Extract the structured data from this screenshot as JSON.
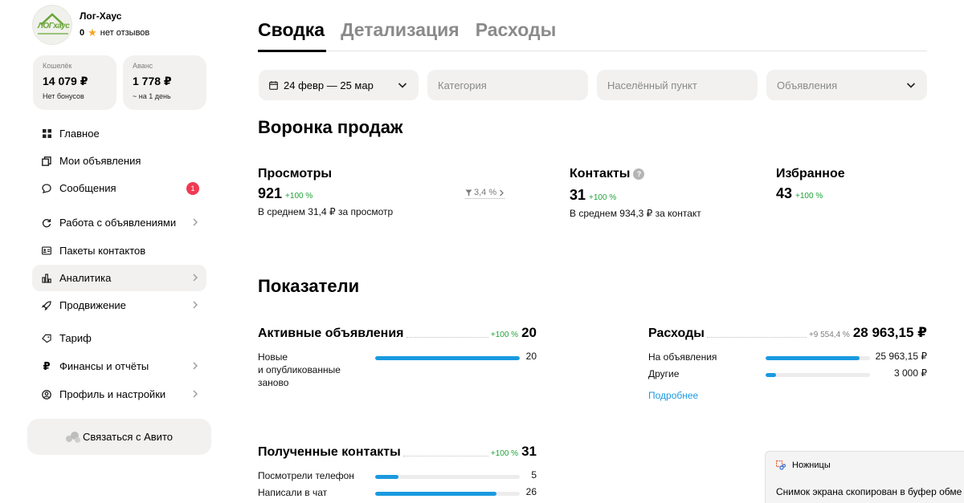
{
  "profile": {
    "name": "Лог-Хаус",
    "logo_text": "ЛОГхаус",
    "rating": "0",
    "reviews": "нет отзывов"
  },
  "wallet": {
    "label": "Кошелёк",
    "value": "14 079 ₽",
    "sub": "Нет бонусов"
  },
  "advance": {
    "label": "Аванс",
    "value": "1 778 ₽",
    "sub": "~ на 1 день"
  },
  "nav": [
    {
      "label": "Главное",
      "icon": "grid-icon"
    },
    {
      "label": "Мои объявления",
      "icon": "copy-icon"
    },
    {
      "label": "Сообщения",
      "icon": "chat-icon",
      "badge": "1"
    },
    {
      "label": "Работа с объявлениями",
      "icon": "refresh-icon"
    },
    {
      "label": "Пакеты контактов",
      "icon": "id-card-icon"
    },
    {
      "label": "Аналитика",
      "icon": "bar-chart-icon"
    },
    {
      "label": "Продвижение",
      "icon": "rocket-icon"
    },
    {
      "label": "Тариф",
      "icon": "tag-icon"
    },
    {
      "label": "Финансы и отчёты",
      "icon": "ruble-icon"
    },
    {
      "label": "Профиль и настройки",
      "icon": "user-icon"
    }
  ],
  "contact_button": "Связаться с Авито",
  "tabs": [
    "Сводка",
    "Детализация",
    "Расходы"
  ],
  "filters": {
    "date": "24 февр — 25 мар",
    "category": "Категория",
    "city": "Населённый пункт",
    "ads": "Объявления"
  },
  "funnel": {
    "title": "Воронка продаж",
    "views": {
      "label": "Просмотры",
      "value": "921",
      "growth": "+100 %",
      "sub": "В среднем 31,4 ₽ за просмотр"
    },
    "conversion": "3,4 %",
    "contacts": {
      "label": "Контакты",
      "value": "31",
      "growth": "+100 %",
      "sub": "В среднем 934,3 ₽ за контакт"
    },
    "favorites": {
      "label": "Избранное",
      "value": "43",
      "growth": "+100 %"
    }
  },
  "indicators": {
    "title": "Показатели",
    "active": {
      "title": "Активные объявления",
      "growth": "+100 %",
      "total": "20",
      "rows": [
        {
          "label": "Новые\nи опубликованные\nзаново",
          "value": "20",
          "fraction": 1.0
        }
      ]
    },
    "expenses": {
      "title": "Расходы",
      "growth": "+9 554,4 %",
      "total": "28 963,15 ₽",
      "rows": [
        {
          "label": "На объявления",
          "value": "25 963,15 ₽",
          "fraction": 0.9
        },
        {
          "label": "Другие",
          "value": "3 000 ₽",
          "fraction": 0.1
        }
      ],
      "link": "Подробнее"
    },
    "contacts": {
      "title": "Полученные контакты",
      "growth": "+100 %",
      "total": "31",
      "rows": [
        {
          "label": "Посмотрели телефон",
          "value": "5",
          "fraction": 0.16
        },
        {
          "label": "Написали в чат",
          "value": "26",
          "fraction": 0.84
        }
      ]
    }
  },
  "toast": {
    "app": "Ножницы",
    "message": "Снимок экрана скопирован в буфер обме"
  },
  "colors": {
    "accent": "#1a9ae0",
    "growth": "#1fa339",
    "badge": "#ef3a52",
    "surface": "#f2f1f0"
  }
}
